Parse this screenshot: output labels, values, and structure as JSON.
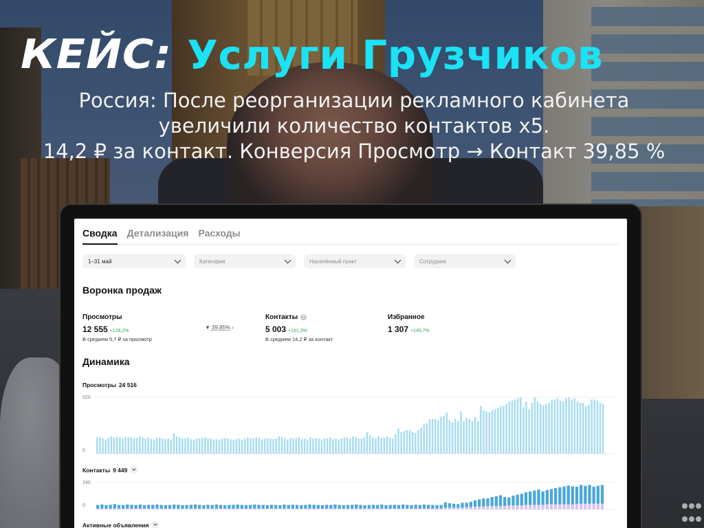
{
  "headline": {
    "kicker": "КЕЙС:",
    "title": "Услуги Грузчиков",
    "subtitle_lines": [
      "Россия: После реорганизации рекламного кабинета",
      "увеличили количество контактов х5.",
      "14,2 ₽ за контакт. Конверсия Просмотр → Контакт 39,85 %"
    ]
  },
  "colors": {
    "title_accent": "#1be2f4",
    "bar_views": "#a9dcf2",
    "bar_contacts": "#4aa7d8",
    "bar_contacts_extra": "#d7c4f0",
    "delta_green": "#2fa84f"
  },
  "tabs": [
    {
      "label": "Сводка",
      "active": true
    },
    {
      "label": "Детализация",
      "active": false
    },
    {
      "label": "Расходы",
      "active": false
    }
  ],
  "filters": [
    {
      "value": "1–31 май",
      "placeholder": false
    },
    {
      "value": "Категория",
      "placeholder": true
    },
    {
      "value": "Населённый пункт",
      "placeholder": true
    },
    {
      "value": "Сотрудник",
      "placeholder": true
    }
  ],
  "funnel": {
    "title": "Воронка продаж",
    "views": {
      "label": "Просмотры",
      "value": "12 555",
      "delta": "+128,2%",
      "note": "В среднем 5,7 ₽ за просмотр"
    },
    "conversion": "39,85%",
    "contacts": {
      "label": "Контакты",
      "info_icon": "info-icon",
      "value": "5 003",
      "delta": "+151,3%",
      "note": "В среднем 14,2 ₽ за контакт"
    },
    "favorites": {
      "label": "Избранное",
      "value": "1 307",
      "delta": "+145,7%"
    }
  },
  "dynamics": {
    "title": "Динамика",
    "views_label": "Просмотры",
    "views_total": "24 516",
    "contacts_label": "Контакты",
    "contacts_total": "9 449",
    "active_label": "Активные объявления"
  },
  "chart_data": [
    {
      "type": "bar",
      "title": "Просмотры",
      "ylim": [
        0,
        520
      ],
      "yticks": [
        "520",
        "0"
      ],
      "values": [
        150,
        150,
        140,
        130,
        150,
        160,
        150,
        155,
        150,
        140,
        155,
        150,
        150,
        140,
        145,
        160,
        150,
        140,
        150,
        135,
        130,
        145,
        150,
        140,
        135,
        140,
        130,
        190,
        160,
        150,
        140,
        145,
        150,
        135,
        130,
        140,
        140,
        145,
        150,
        140,
        140,
        130,
        135,
        130,
        140,
        145,
        140,
        135,
        130,
        135,
        140,
        130,
        140,
        150,
        145,
        140,
        150,
        150,
        130,
        140,
        145,
        140,
        135,
        140,
        160,
        150,
        140,
        130,
        145,
        140,
        145,
        150,
        135,
        140,
        130,
        150,
        140,
        145,
        140,
        130,
        140,
        140,
        150,
        135,
        140,
        130,
        140,
        150,
        150,
        140,
        160,
        150,
        140,
        140,
        150,
        200,
        170,
        150,
        140,
        160,
        145,
        150,
        160,
        150,
        140,
        180,
        230,
        200,
        210,
        220,
        215,
        200,
        190,
        220,
        240,
        270,
        280,
        320,
        320,
        320,
        310,
        340,
        350,
        380,
        310,
        290,
        320,
        300,
        390,
        300,
        330,
        320,
        300,
        340,
        300,
        440,
        400,
        390,
        380,
        400,
        410,
        420,
        440,
        440,
        460,
        480,
        490,
        500,
        510,
        520,
        430,
        480,
        410,
        470,
        520,
        480,
        460,
        450,
        460,
        470,
        500,
        500,
        510,
        490,
        480,
        510,
        520,
        500,
        510,
        480,
        470,
        470,
        440,
        450,
        500,
        500,
        490,
        470,
        460
      ],
      "values_truncated_note": ""
    },
    {
      "type": "bar",
      "title": "Контакты",
      "ylim": [
        0,
        240
      ],
      "yticks": [
        "240",
        "0"
      ],
      "series": [
        {
          "name": "",
          "values": [
            40,
            45,
            38,
            42,
            50,
            40,
            38,
            45,
            42,
            40,
            45,
            38,
            40,
            42,
            45,
            40,
            38,
            40,
            45,
            42,
            38,
            40,
            42,
            45,
            40,
            38,
            42,
            40,
            45,
            40,
            38,
            40,
            42,
            45,
            40,
            38,
            40,
            45,
            42,
            40,
            38,
            42,
            40,
            38,
            45,
            40,
            42,
            40,
            38,
            40,
            45,
            42,
            40,
            38,
            42,
            40,
            45,
            40,
            38,
            40,
            42,
            45,
            40,
            38,
            40,
            42,
            40,
            45,
            38,
            40,
            42,
            40,
            45,
            40,
            38,
            42,
            40,
            45,
            42,
            40,
            38,
            40,
            60,
            50,
            45,
            40,
            55,
            50,
            60,
            70,
            80,
            90,
            85,
            100,
            110,
            120,
            100,
            90,
            110,
            120,
            130,
            140,
            150,
            160,
            170,
            150,
            160,
            170,
            180,
            190,
            200,
            210,
            200,
            190,
            210,
            200,
            210,
            190,
            200,
            210
          ]
        },
        {
          "name": "",
          "values": [
            8,
            8,
            8,
            8,
            8,
            8,
            8,
            8,
            8,
            8,
            8,
            8,
            8,
            8,
            8,
            8,
            8,
            8,
            8,
            8,
            8,
            8,
            8,
            8,
            8,
            8,
            8,
            8,
            8,
            8,
            8,
            8,
            8,
            8,
            8,
            8,
            8,
            8,
            8,
            8,
            8,
            8,
            8,
            8,
            8,
            8,
            8,
            8,
            8,
            8,
            8,
            8,
            8,
            8,
            8,
            8,
            8,
            8,
            8,
            8,
            8,
            8,
            8,
            8,
            8,
            8,
            8,
            8,
            8,
            8,
            8,
            8,
            8,
            8,
            8,
            8,
            8,
            8,
            8,
            8,
            8,
            8,
            15,
            15,
            15,
            15,
            15,
            20,
            20,
            25,
            25,
            25,
            30,
            30,
            30,
            30,
            30,
            35,
            35,
            35,
            35,
            40,
            40,
            40,
            40,
            40,
            45,
            45,
            45,
            45,
            45,
            45,
            45,
            50,
            50,
            50,
            50,
            50,
            50,
            50
          ]
        }
      ]
    }
  ]
}
